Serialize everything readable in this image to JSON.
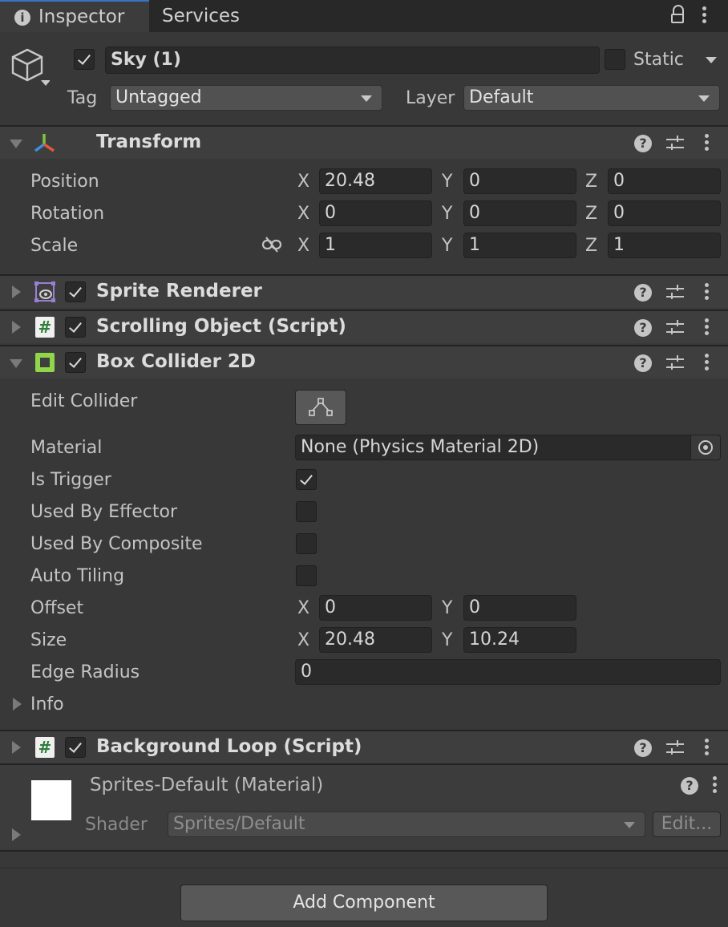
{
  "tabs": {
    "inspector": "Inspector",
    "services": "Services"
  },
  "object": {
    "enabled": true,
    "name": "Sky (1)",
    "static_label": "Static",
    "tag_label": "Tag",
    "tag_value": "Untagged",
    "layer_label": "Layer",
    "layer_value": "Default"
  },
  "transform": {
    "title": "Transform",
    "rows": [
      {
        "label": "Position",
        "x": "20.48",
        "y": "0",
        "z": "0"
      },
      {
        "label": "Rotation",
        "x": "0",
        "y": "0",
        "z": "0"
      },
      {
        "label": "Scale",
        "x": "1",
        "y": "1",
        "z": "1"
      }
    ],
    "axis": {
      "x": "X",
      "y": "Y",
      "z": "Z"
    }
  },
  "sprite_renderer": {
    "title": "Sprite Renderer"
  },
  "scrolling_object": {
    "title": "Scrolling Object (Script)"
  },
  "box_collider": {
    "title": "Box Collider 2D",
    "edit_collider_label": "Edit Collider",
    "material_label": "Material",
    "material_value": "None (Physics Material 2D)",
    "is_trigger_label": "Is Trigger",
    "is_trigger": true,
    "used_by_effector_label": "Used By Effector",
    "used_by_composite_label": "Used By Composite",
    "auto_tiling_label": "Auto Tiling",
    "offset_label": "Offset",
    "offset_x": "0",
    "offset_y": "0",
    "size_label": "Size",
    "size_x": "20.48",
    "size_y": "10.24",
    "edge_radius_label": "Edge Radius",
    "edge_radius_value": "0",
    "info_label": "Info"
  },
  "background_loop": {
    "title": "Background Loop (Script)"
  },
  "material": {
    "name": "Sprites-Default (Material)",
    "shader_label": "Shader",
    "shader_value": "Sprites/Default",
    "edit_label": "Edit..."
  },
  "add_component_label": "Add Component",
  "icons": {
    "info": "info-icon",
    "lock": "lock-icon",
    "menu": "kebab-menu-icon",
    "gameobject": "cube-icon",
    "transform": "transform-axes-icon",
    "sprite": "sprite-renderer-icon",
    "script": "script-hash-icon",
    "collider": "box-collider-icon",
    "help": "help-icon",
    "presets": "presets-icon",
    "link": "unlinked-chain-icon",
    "picker": "object-picker-icon"
  },
  "colors": {
    "background": "#383838",
    "header": "#3e3e3e",
    "field": "#2a2a2a",
    "accent": "#3a72c7"
  }
}
